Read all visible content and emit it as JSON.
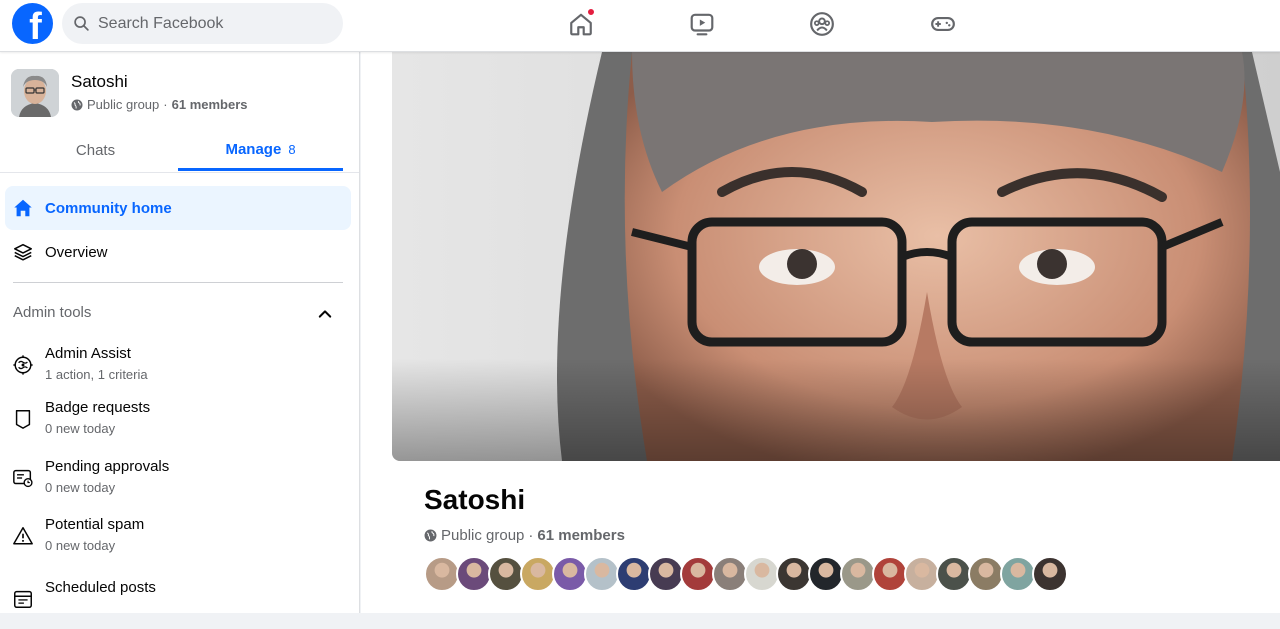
{
  "topbar": {
    "logo_letter": "f",
    "search_placeholder": "Search Facebook",
    "nav": [
      {
        "icon": "home-icon",
        "has_notification_dot": true
      },
      {
        "icon": "video-icon"
      },
      {
        "icon": "groups-icon"
      },
      {
        "icon": "gaming-icon"
      }
    ]
  },
  "group": {
    "name": "Satoshi",
    "privacy": "Public group",
    "separator": "·",
    "members": "61 members"
  },
  "tabs": [
    {
      "label": "Chats",
      "active": false
    },
    {
      "label": "Manage",
      "count": "8",
      "active": true
    }
  ],
  "menu": [
    {
      "label": "Community home",
      "icon": "home-icon",
      "active": true
    },
    {
      "label": "Overview",
      "icon": "layers-icon",
      "active": false
    }
  ],
  "admin_tools": {
    "title": "Admin tools",
    "items": [
      {
        "title": "Admin Assist",
        "subtitle": "1 action, 1 criteria",
        "icon": "admin-assist-icon"
      },
      {
        "title": "Badge requests",
        "subtitle": "0 new today",
        "icon": "badge-icon"
      },
      {
        "title": "Pending approvals",
        "subtitle": "0 new today",
        "icon": "pending-approvals-icon"
      },
      {
        "title": "Potential spam",
        "subtitle": "0 new today",
        "icon": "warning-icon"
      },
      {
        "title": "Scheduled posts",
        "subtitle": "",
        "icon": "calendar-icon"
      }
    ]
  },
  "colors": {
    "brand": "#0866ff",
    "active_bg": "#ebf5ff",
    "notification": "#e41e3f",
    "muted_text": "#65676b"
  },
  "member_avatar_colors": [
    "#b79b86",
    "#6b4a7a",
    "#55503f",
    "#c9a862",
    "#7a5aa8",
    "#b4c1c9",
    "#2d3d72",
    "#473b52",
    "#a33b3b",
    "#8a7f79",
    "#d7d7d0",
    "#3b3632",
    "#22262b",
    "#9a9889",
    "#b0433a",
    "#c7b09e",
    "#4b514a",
    "#8b7c64",
    "#7fa4a0",
    "#3c3330"
  ]
}
